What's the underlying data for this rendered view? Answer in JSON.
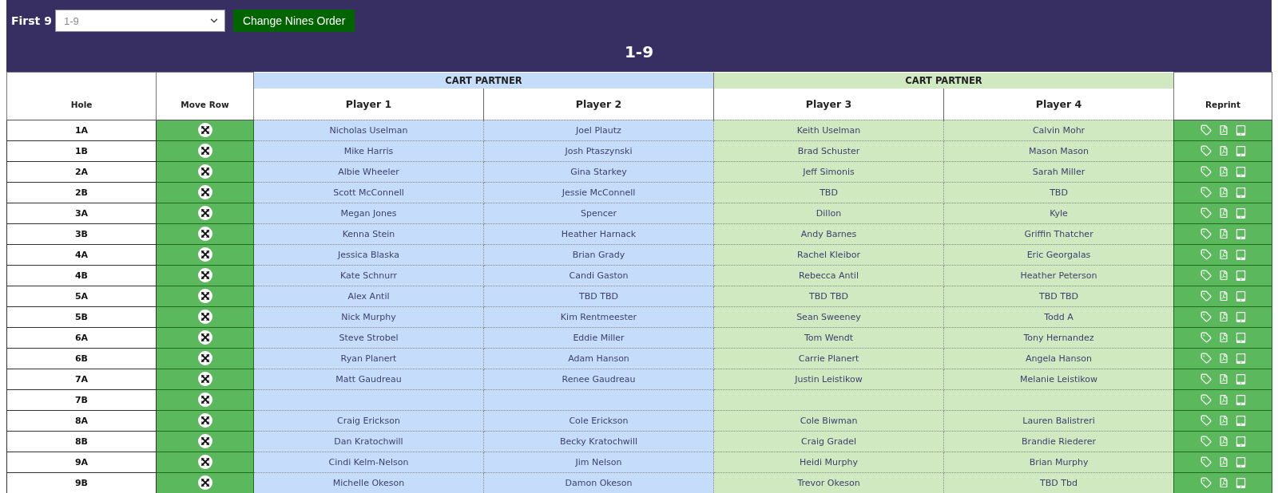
{
  "toolbar": {
    "label": "First 9",
    "select": {
      "value": "1-9"
    },
    "button": "Change Nines Order"
  },
  "title": "1-9",
  "table": {
    "columns": [
      {
        "kind": "hole",
        "label": "Hole"
      },
      {
        "kind": "move",
        "label": "Move Row"
      },
      {
        "kind": "group",
        "label": "CART PARTNER",
        "color": "#c5ddfa",
        "columns": [
          "Player 1",
          "Player 2"
        ]
      },
      {
        "kind": "group",
        "label": "CART PARTNER",
        "color": "#d1e9c0",
        "columns": [
          "Player 3",
          "Player 4"
        ]
      },
      {
        "kind": "reprint",
        "label": "Reprint"
      }
    ],
    "rows": [
      {
        "hole": "1A",
        "players": [
          "Nicholas Uselman",
          "Joel Plautz",
          "Keith Uselman",
          "Calvin Mohr"
        ]
      },
      {
        "hole": "1B",
        "players": [
          "Mike Harris",
          "Josh Ptaszynski",
          "Brad Schuster",
          "Mason Mason"
        ]
      },
      {
        "hole": "2A",
        "players": [
          "Albie Wheeler",
          "Gina Starkey",
          "Jeff Simonis",
          "Sarah Miller"
        ]
      },
      {
        "hole": "2B",
        "players": [
          "Scott McConnell",
          "Jessie McConnell",
          "TBD",
          "TBD"
        ]
      },
      {
        "hole": "3A",
        "players": [
          "Megan Jones",
          "Spencer",
          "Dillon",
          "Kyle"
        ]
      },
      {
        "hole": "3B",
        "players": [
          "Kenna Stein",
          "Heather Harnack",
          "Andy Barnes",
          "Griffin Thatcher"
        ]
      },
      {
        "hole": "4A",
        "players": [
          "Jessica Blaska",
          "Brian Grady",
          "Rachel Kleibor",
          "Eric Georgalas"
        ]
      },
      {
        "hole": "4B",
        "players": [
          "Kate Schnurr",
          "Candi Gaston",
          "Rebecca Antil",
          "Heather Peterson"
        ]
      },
      {
        "hole": "5A",
        "players": [
          "Alex Antil",
          "TBD TBD",
          "TBD TBD",
          "TBD TBD"
        ]
      },
      {
        "hole": "5B",
        "players": [
          "Nick Murphy",
          "Kim Rentmeester",
          "Sean Sweeney",
          "Todd A"
        ]
      },
      {
        "hole": "6A",
        "players": [
          "Steve Strobel",
          "Eddie Miller",
          "Tom Wendt",
          "Tony Hernandez"
        ]
      },
      {
        "hole": "6B",
        "players": [
          "Ryan Planert",
          "Adam Hanson",
          "Carrie Planert",
          "Angela Hanson"
        ]
      },
      {
        "hole": "7A",
        "players": [
          "Matt Gaudreau",
          "Renee Gaudreau",
          "Justin Leistikow",
          "Melanie Leistikow"
        ]
      },
      {
        "hole": "7B"
      },
      {
        "hole": "8A",
        "players": [
          "Craig Erickson",
          "Cole Erickson",
          "Cole Biwman",
          "Lauren Balistreri"
        ]
      },
      {
        "hole": "8B",
        "players": [
          "Dan Kratochwill",
          "Becky Kratochwill",
          "Craig Gradel",
          "Brandie Riederer"
        ]
      },
      {
        "hole": "9A",
        "players": [
          "Cindi Kelm-Nelson",
          "Jim Nelson",
          "Heidi Murphy",
          "Brian Murphy"
        ]
      },
      {
        "hole": "9B",
        "players": [
          "Michelle Okeson",
          "Damon Okeson",
          "Trevor Okeson",
          "TBD Tbd"
        ]
      }
    ]
  }
}
